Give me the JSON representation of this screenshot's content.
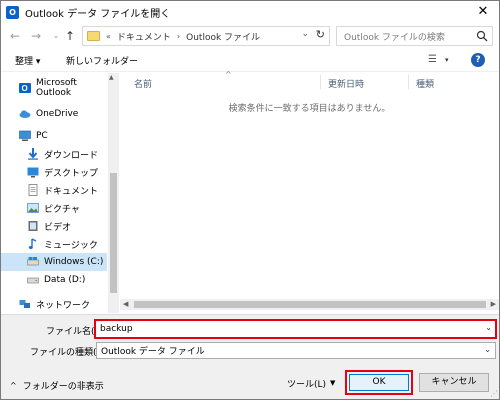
{
  "window": {
    "title": "Outlook データ ファイルを開く",
    "app_icon_letter": "O",
    "close_glyph": "✕"
  },
  "navigation": {
    "back_glyph": "←",
    "forward_glyph": "→",
    "history_glyph": "⌄",
    "up_glyph": "↑",
    "breadcrumb_overflow": "«",
    "breadcrumbs": [
      "ドキュメント",
      "Outlook ファイル"
    ],
    "breadcrumb_separator": "›",
    "address_dropdown_glyph": "⌄",
    "refresh_glyph": "↻",
    "search_placeholder": "Outlook ファイルの検索"
  },
  "toolbar": {
    "organize_label": "整理 ▾",
    "new_folder_label": "新しいフォルダー",
    "view_glyph": "☰",
    "view_drop_glyph": "▾",
    "help_glyph": "?"
  },
  "sidebar": {
    "items": [
      {
        "label": "Microsoft Outlook",
        "icon": "outlook-icon"
      },
      {
        "label": "OneDrive",
        "icon": "onedrive-icon"
      },
      {
        "label": "PC",
        "icon": "pc-icon"
      },
      {
        "label": "ダウンロード",
        "icon": "downloads-icon"
      },
      {
        "label": "デスクトップ",
        "icon": "desktop-icon"
      },
      {
        "label": "ドキュメント",
        "icon": "documents-icon"
      },
      {
        "label": "ピクチャ",
        "icon": "pictures-icon"
      },
      {
        "label": "ビデオ",
        "icon": "videos-icon"
      },
      {
        "label": "ミュージック",
        "icon": "music-icon"
      },
      {
        "label": "Windows (C:)",
        "icon": "drive-c-icon",
        "selected": true
      },
      {
        "label": "Data (D:)",
        "icon": "drive-d-icon"
      },
      {
        "label": "ネットワーク",
        "icon": "network-icon"
      }
    ]
  },
  "file_list": {
    "columns": [
      "名前",
      "更新日時",
      "種類"
    ],
    "sort_glyph": "^",
    "empty_message": "検索条件に一致する項目はありません。"
  },
  "footer": {
    "filename_label": "ファイル名(N):",
    "filename_value": "backup",
    "filetype_label": "ファイルの種類(T):",
    "filetype_value": "Outlook データ ファイル",
    "dropdown_glyph": "⌄",
    "hide_folders_label": "フォルダーの非表示",
    "hide_folders_caret": "^",
    "tools_label": "ツール(L)",
    "tools_drop_glyph": "▼",
    "ok_label": "OK",
    "cancel_label": "キャンセル"
  },
  "colors": {
    "highlight_red": "#e60012",
    "selection_blue": "#cce4f7",
    "accent_blue": "#0078d7"
  }
}
